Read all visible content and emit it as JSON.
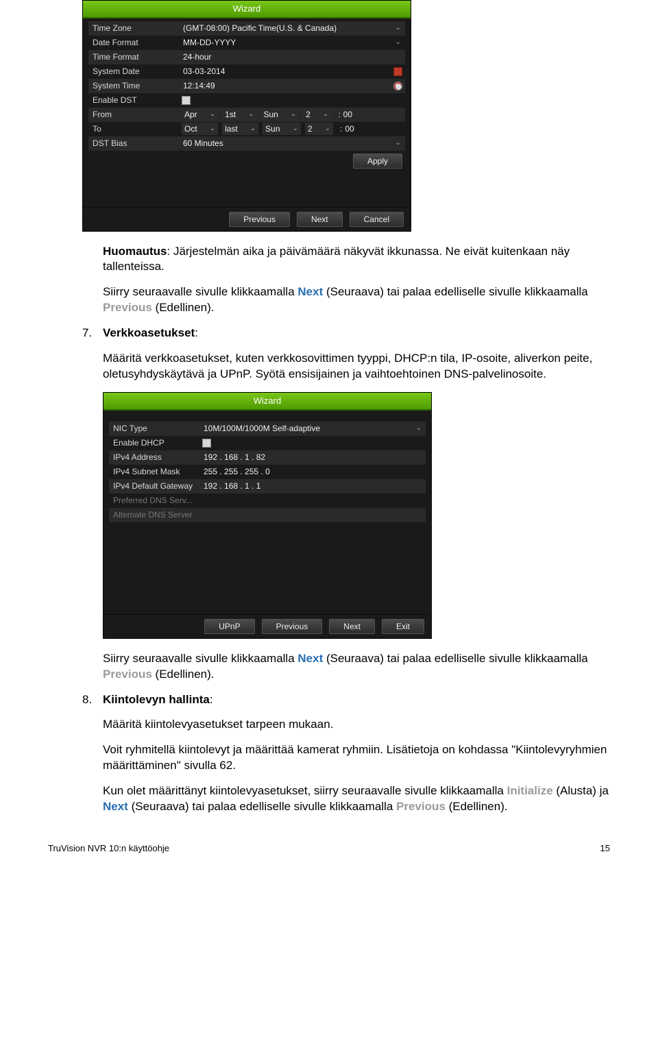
{
  "wizard1": {
    "title": "Wizard",
    "timezone_label": "Time Zone",
    "timezone_value": "(GMT-08:00) Pacific Time(U.S. & Canada)",
    "dateformat_label": "Date Format",
    "dateformat_value": "MM-DD-YYYY",
    "timeformat_label": "Time Format",
    "timeformat_value": "24-hour",
    "sysdate_label": "System Date",
    "sysdate_value": "03-03-2014",
    "systime_label": "System Time",
    "systime_value": "12:14:49",
    "enabledst_label": "Enable DST",
    "from_label": "From",
    "from_m": "Apr",
    "from_w": "1st",
    "from_d": "Sun",
    "from_h": "2",
    "from_min": "00",
    "to_label": "To",
    "to_m": "Oct",
    "to_w": "last",
    "to_d": "Sun",
    "to_h": "2",
    "to_min": "00",
    "dstbias_label": "DST Bias",
    "dstbias_value": "60 Minutes",
    "apply": "Apply",
    "prev": "Previous",
    "next": "Next",
    "cancel": "Cancel"
  },
  "wizard2": {
    "title": "Wizard",
    "nic_label": "NIC Type",
    "nic_value": "10M/100M/1000M Self-adaptive",
    "dhcp_label": "Enable DHCP",
    "ipv4_label": "IPv4 Address",
    "ipv4_value": "192 . 168 . 1     . 82",
    "mask_label": "IPv4 Subnet Mask",
    "mask_value": "255 . 255 . 255 . 0",
    "gw_label": "IPv4 Default Gateway",
    "gw_value": "192 . 168 . 1     . 1",
    "pref_label": "Preferred DNS Serv...",
    "alt_label": "Alternate DNS Server",
    "upnp": "UPnP",
    "prev": "Previous",
    "next": "Next",
    "exit": "Exit"
  },
  "doc": {
    "note_label": "Huomautus",
    "note_text": ": Järjestelmän aika ja päivämäärä näkyvät ikkunassa. Ne eivät kuitenkaan näy tallenteissa.",
    "nav1_a": "Siirry seuraavalle sivulle klikkaamalla ",
    "nav1_next": "Next",
    "nav1_b": " (Seuraava) tai palaa edelliselle sivulle klikkaamalla ",
    "nav1_prev": "Previous",
    "nav1_c": " (Edellinen).",
    "item7_num": "7.",
    "item7_title": "Verkkoasetukset",
    "item7_colon": ":",
    "item7_p1": "Määritä verkkoasetukset, kuten verkkosovittimen tyyppi, DHCP:n tila, IP-osoite, aliverkon peite, oletusyhdyskäytävä ja UPnP. Syötä ensisijainen ja vaihtoehtoinen DNS-palvelinosoite.",
    "nav2_a": "Siirry seuraavalle sivulle klikkaamalla ",
    "nav2_next": "Next",
    "nav2_b": " (Seuraava) tai palaa edelliselle sivulle klikkaamalla ",
    "nav2_prev": "Previous",
    "nav2_c": " (Edellinen).",
    "item8_num": "8.",
    "item8_title": "Kiintolevyn hallinta",
    "item8_colon": ":",
    "item8_p1": "Määritä kiintolevyasetukset tarpeen mukaan.",
    "item8_p2": "Voit ryhmitellä kiintolevyt ja määrittää kamerat ryhmiin. Lisätietoja on kohdassa \"Kiintolevyryhmien määrittäminen\" sivulla 62.",
    "item8_p3a": "Kun olet määrittänyt kiintolevyasetukset, siirry seuraavalle sivulle klikkaamalla ",
    "item8_init": "Initialize",
    "item8_p3b": " (Alusta) ja ",
    "item8_next": "Next",
    "item8_p3c": " (Seuraava) tai palaa edelliselle sivulle klikkaamalla ",
    "item8_prev": "Previous",
    "item8_p3d": " (Edellinen)."
  },
  "footer": {
    "left": "TruVision NVR 10:n käyttöohje",
    "right": "15"
  }
}
